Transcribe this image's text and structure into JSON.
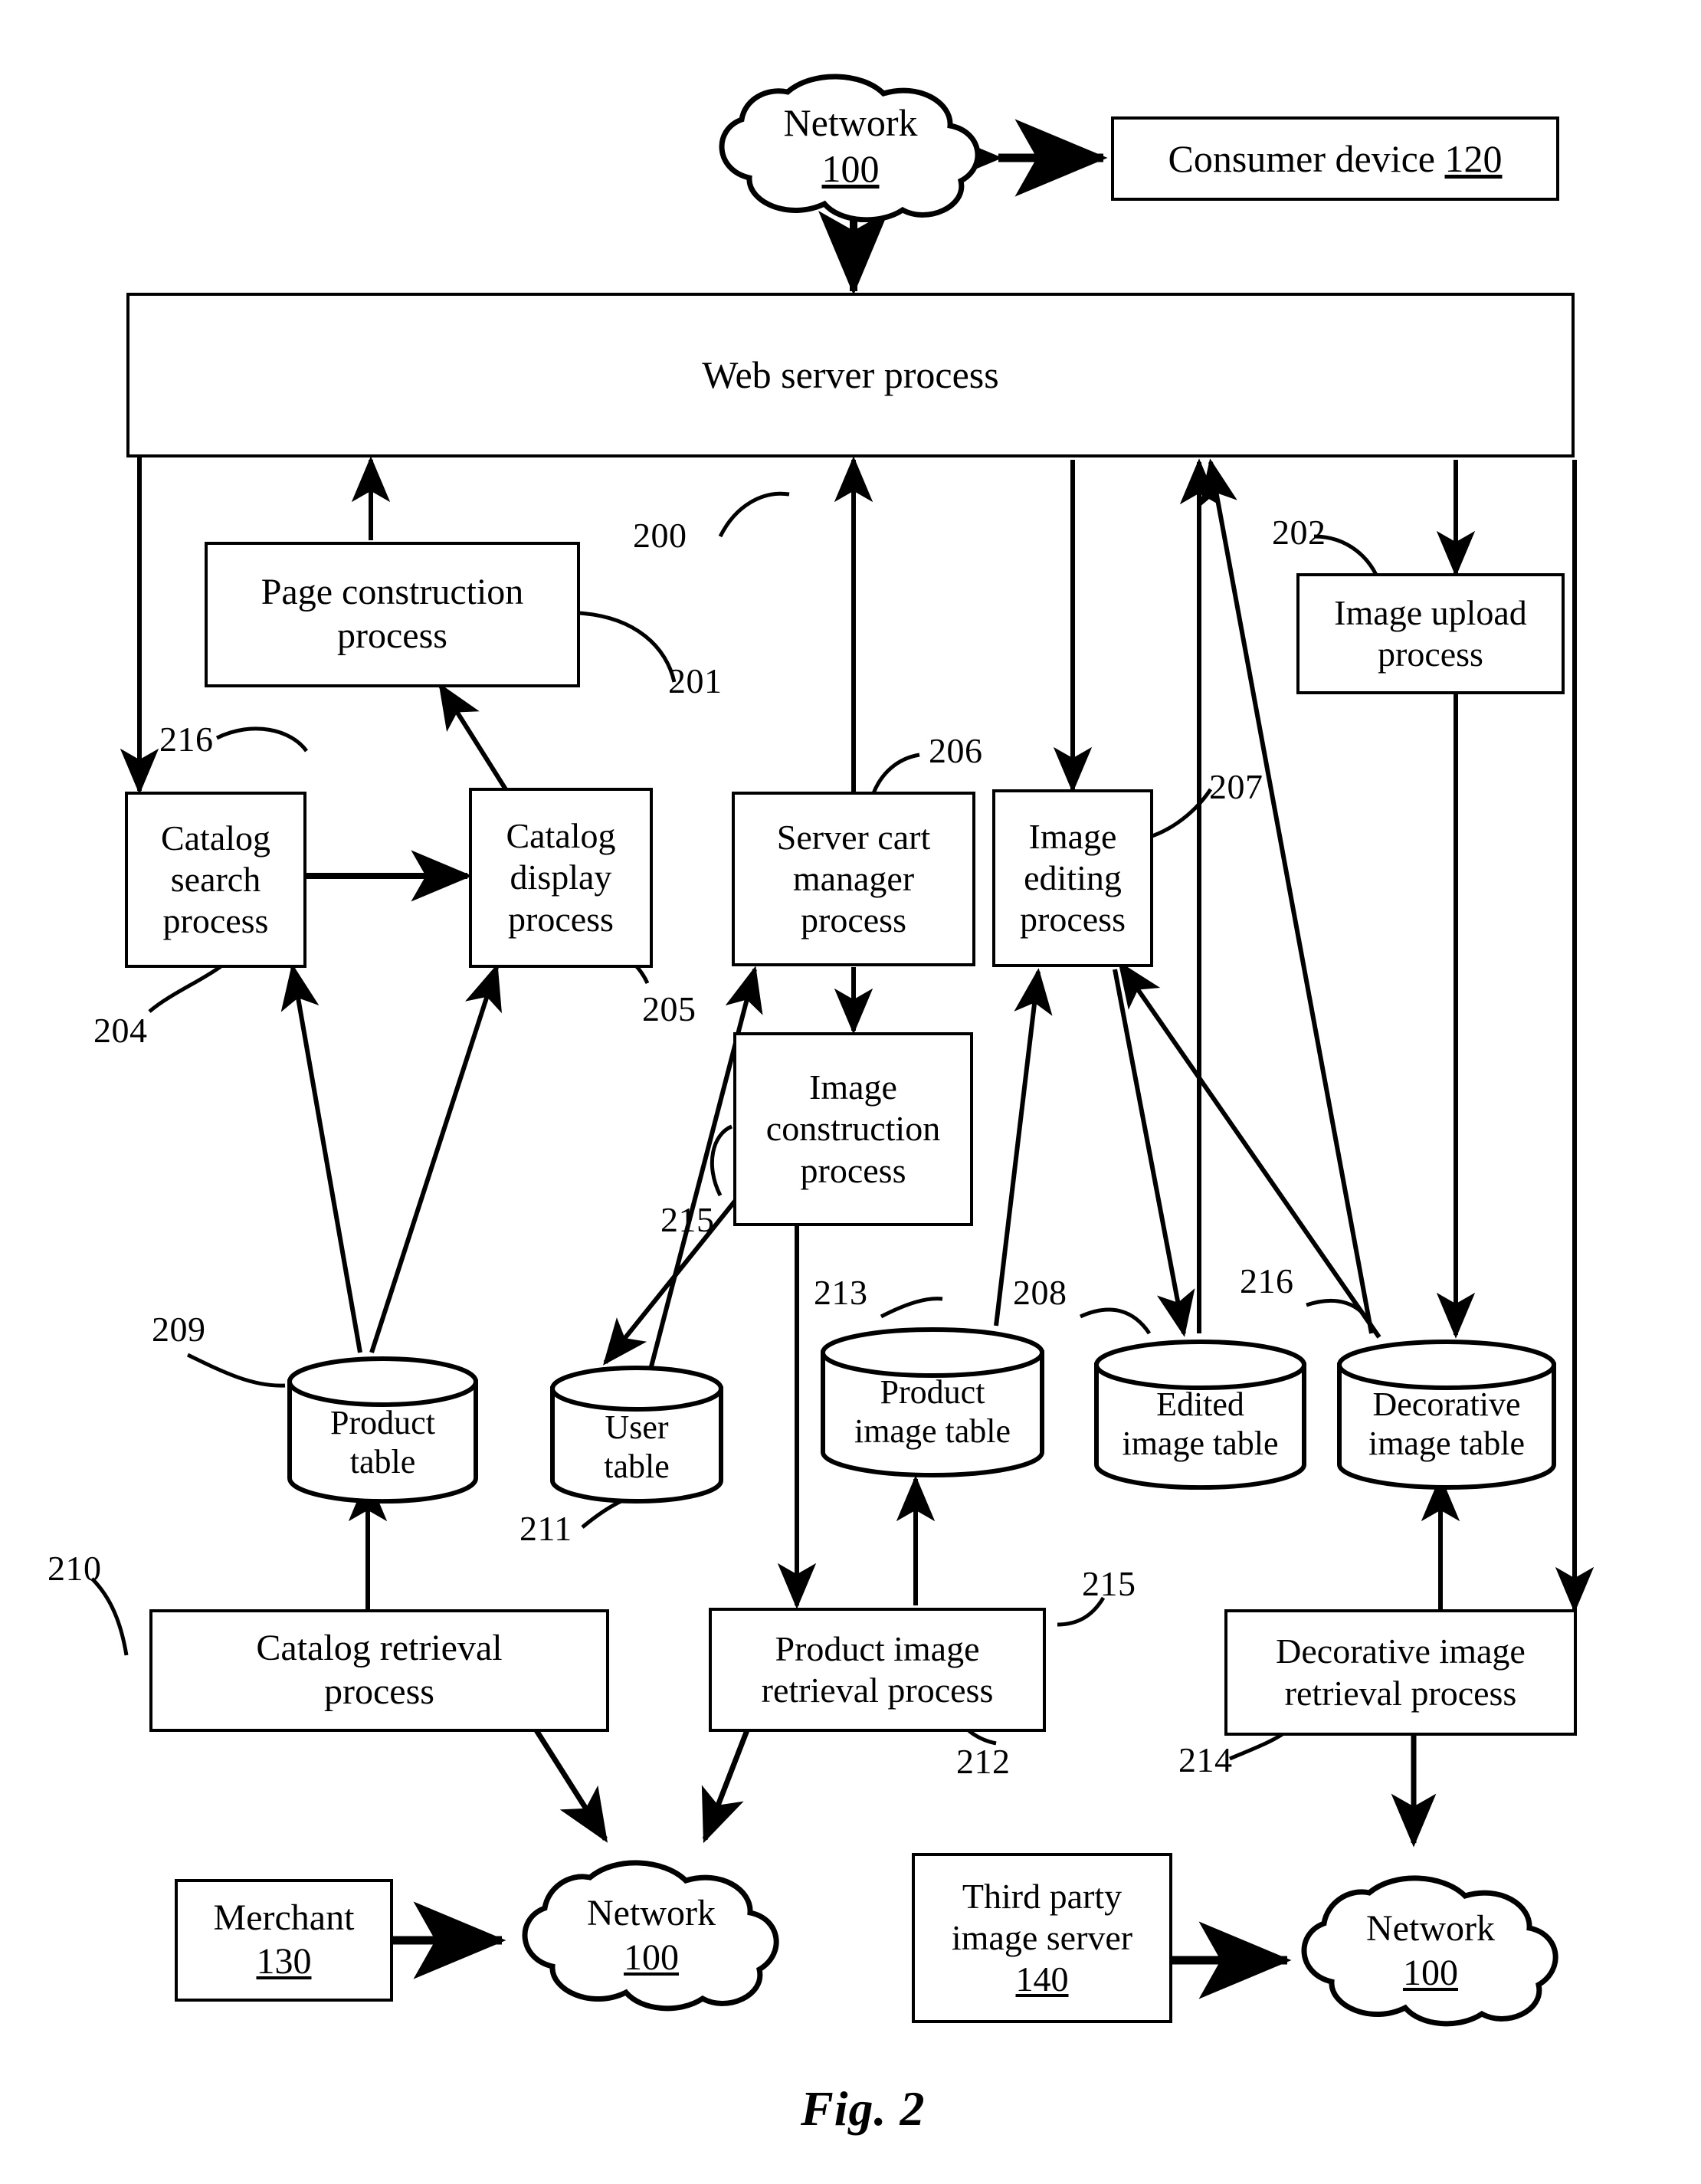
{
  "figure": {
    "caption": "Fig. 2",
    "domain_note": "patent flow diagram"
  },
  "nodes": {
    "network_top": {
      "line1": "Network",
      "line2": "100"
    },
    "consumer_device": {
      "text": "Consumer device ",
      "ref": "120"
    },
    "web_server_process": {
      "label": "Web server process"
    },
    "page_construction_process": {
      "label": "Page construction\nprocess"
    },
    "image_upload_process": {
      "label": "Image upload\nprocess"
    },
    "catalog_search_process": {
      "label": "Catalog\nsearch\nprocess"
    },
    "catalog_display_process": {
      "label": "Catalog\ndisplay\nprocess"
    },
    "server_cart_manager_process": {
      "label": "Server cart\nmanager\nprocess"
    },
    "image_editing_process": {
      "label": "Image\nediting\nprocess"
    },
    "image_construction_process": {
      "label": "Image\nconstruction\nprocess"
    },
    "product_table": {
      "label": "Product\ntable"
    },
    "user_table": {
      "label": "User\ntable"
    },
    "product_image_table": {
      "label": "Product\nimage table"
    },
    "edited_image_table": {
      "label": "Edited\nimage table"
    },
    "decorative_image_table": {
      "label": "Decorative\nimage table"
    },
    "catalog_retrieval_process": {
      "label": "Catalog retrieval\nprocess"
    },
    "product_image_retrieval_process": {
      "label": "Product image\nretrieval process"
    },
    "decorative_image_retrieval_process": {
      "label": "Decorative image\nretrieval process"
    },
    "merchant": {
      "line1": "Merchant",
      "line2": "130"
    },
    "network_bottom_left": {
      "line1": "Network",
      "line2": "100"
    },
    "third_party_image_server": {
      "line1": "Third party",
      "line2": "image server",
      "line3": "140"
    },
    "network_bottom_right": {
      "line1": "Network",
      "line2": "100"
    }
  },
  "reference_numerals": {
    "ref_200": "200",
    "ref_201": "201",
    "ref_202": "202",
    "ref_216_top": "216",
    "ref_204": "204",
    "ref_205": "205",
    "ref_206": "206",
    "ref_207": "207",
    "ref_215_mid": "215",
    "ref_209": "209",
    "ref_211": "211",
    "ref_213": "213",
    "ref_208": "208",
    "ref_216_right": "216",
    "ref_210": "210",
    "ref_212": "212",
    "ref_214": "214",
    "ref_215_right": "215"
  },
  "colors": {
    "stroke": "#000000",
    "background": "#ffffff"
  }
}
